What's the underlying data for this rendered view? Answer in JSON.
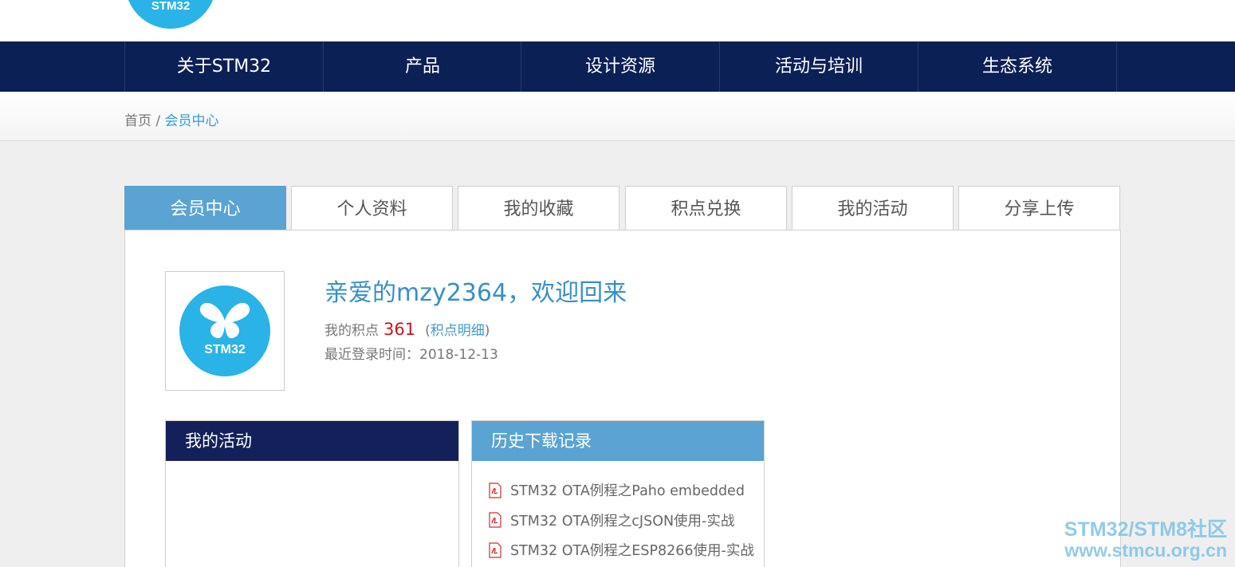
{
  "logo": {
    "text": "STM32"
  },
  "nav": {
    "items": [
      "关于STM32",
      "产品",
      "设计资源",
      "活动与培训",
      "生态系统"
    ]
  },
  "breadcrumb": {
    "home": "首页",
    "separator": " / ",
    "current": "会员中心"
  },
  "tabs": [
    "会员中心",
    "个人资料",
    "我的收藏",
    "积点兑换",
    "我的活动",
    "分享上传"
  ],
  "profile": {
    "avatar_text": "STM32",
    "welcome": "亲爱的mzy2364，欢迎回来",
    "points_label": "我的积点",
    "points_value": "361",
    "points_link_open": "(",
    "points_link": "积点明细",
    "points_link_close": ")",
    "last_login": "最近登录时间：2018-12-13"
  },
  "activities": {
    "title": "我的活动"
  },
  "downloads": {
    "title": "历史下载记录",
    "items": [
      "STM32 OTA例程之Paho embedded",
      "STM32 OTA例程之cJSON使用-实战",
      "STM32 OTA例程之ESP8266使用-实战"
    ]
  },
  "watermark": {
    "line1": "STM32/STM8社区",
    "line2": "www.stmcu.org.cn"
  },
  "colors": {
    "nav_bg": "#0b2055",
    "tab_active": "#5aa3d3",
    "link": "#3a9bd0",
    "points": "#c8161d",
    "logo": "#2ab3e6"
  }
}
